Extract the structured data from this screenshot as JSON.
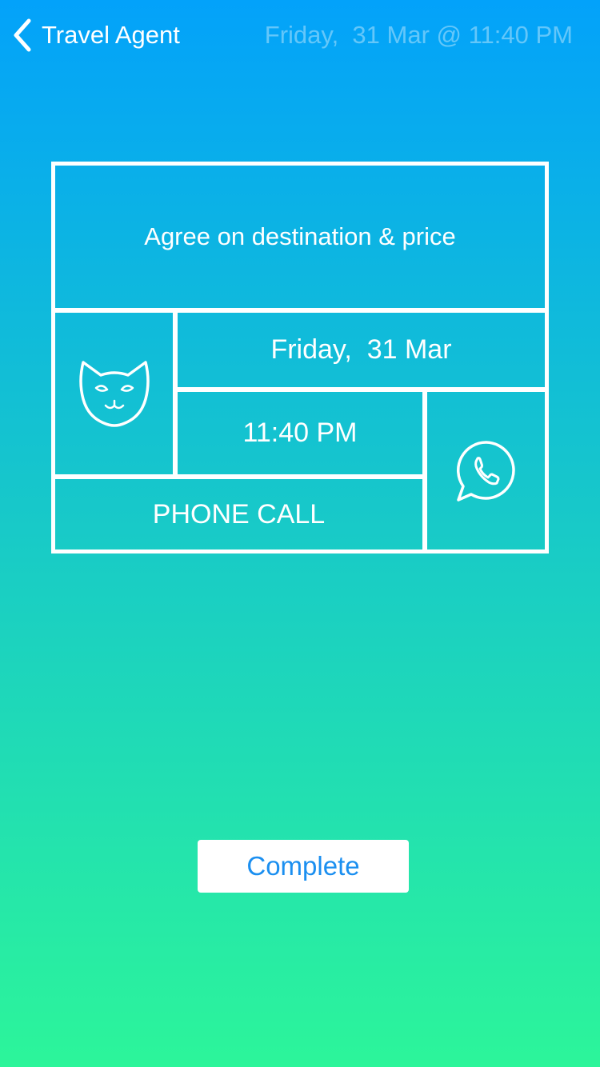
{
  "nav": {
    "back_label": "Travel Agent",
    "datetime": "Friday,  31 Mar @ 11:40 PM"
  },
  "card": {
    "task": "Agree on destination & price",
    "date": "Friday,  31 Mar",
    "time": "11:40 PM",
    "method": "PHONE CALL",
    "avatar_icon": "cat-face-icon",
    "contact_icon": "whatsapp-icon"
  },
  "actions": {
    "complete_label": "Complete"
  },
  "colors": {
    "gradient_top": "#03a2fa",
    "gradient_bottom": "#2cf59a",
    "button_text": "#1b8ff0",
    "nav_datetime": "rgba(255,255,255,0.38)"
  }
}
